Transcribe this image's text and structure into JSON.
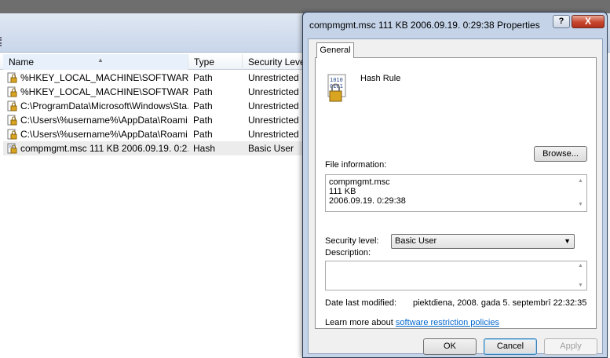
{
  "list": {
    "columns": {
      "name": "Name",
      "type": "Type",
      "security": "Security Level"
    },
    "rows": [
      {
        "name": "%HKEY_LOCAL_MACHINE\\SOFTWARE\\...",
        "type": "Path",
        "security": "Unrestricted"
      },
      {
        "name": "%HKEY_LOCAL_MACHINE\\SOFTWARE\\...",
        "type": "Path",
        "security": "Unrestricted"
      },
      {
        "name": "C:\\ProgramData\\Microsoft\\Windows\\Sta...",
        "type": "Path",
        "security": "Unrestricted"
      },
      {
        "name": "C:\\Users\\%username%\\AppData\\Roami...",
        "type": "Path",
        "security": "Unrestricted"
      },
      {
        "name": "C:\\Users\\%username%\\AppData\\Roami...",
        "type": "Path",
        "security": "Unrestricted"
      },
      {
        "name": "compmgmt.msc  111  KB  2006.09.19.  0:2...",
        "type": "Hash",
        "security": "Basic User"
      }
    ]
  },
  "dialog": {
    "title": "compmgmt.msc  111  KB  2006.09.19.  0:29:38 Properties",
    "help_label": "?",
    "close_label": "X",
    "tab_general": "General",
    "rule_label": "Hash Rule",
    "browse_label": "Browse...",
    "file_info_label": "File information:",
    "file_info_lines": [
      "compmgmt.msc",
      "111  KB",
      "2006.09.19.  0:29:38"
    ],
    "security_level_label": "Security level:",
    "security_level_value": "Basic User",
    "description_label": "Description:",
    "date_modified_label": "Date last modified:",
    "date_modified_value": "piektdiena, 2008. gada 5. septembrī  22:32:35",
    "learn_more_prefix": "Learn more about ",
    "learn_more_link": "software restriction policies",
    "ok_label": "OK",
    "cancel_label": "Cancel",
    "apply_label": "Apply"
  }
}
